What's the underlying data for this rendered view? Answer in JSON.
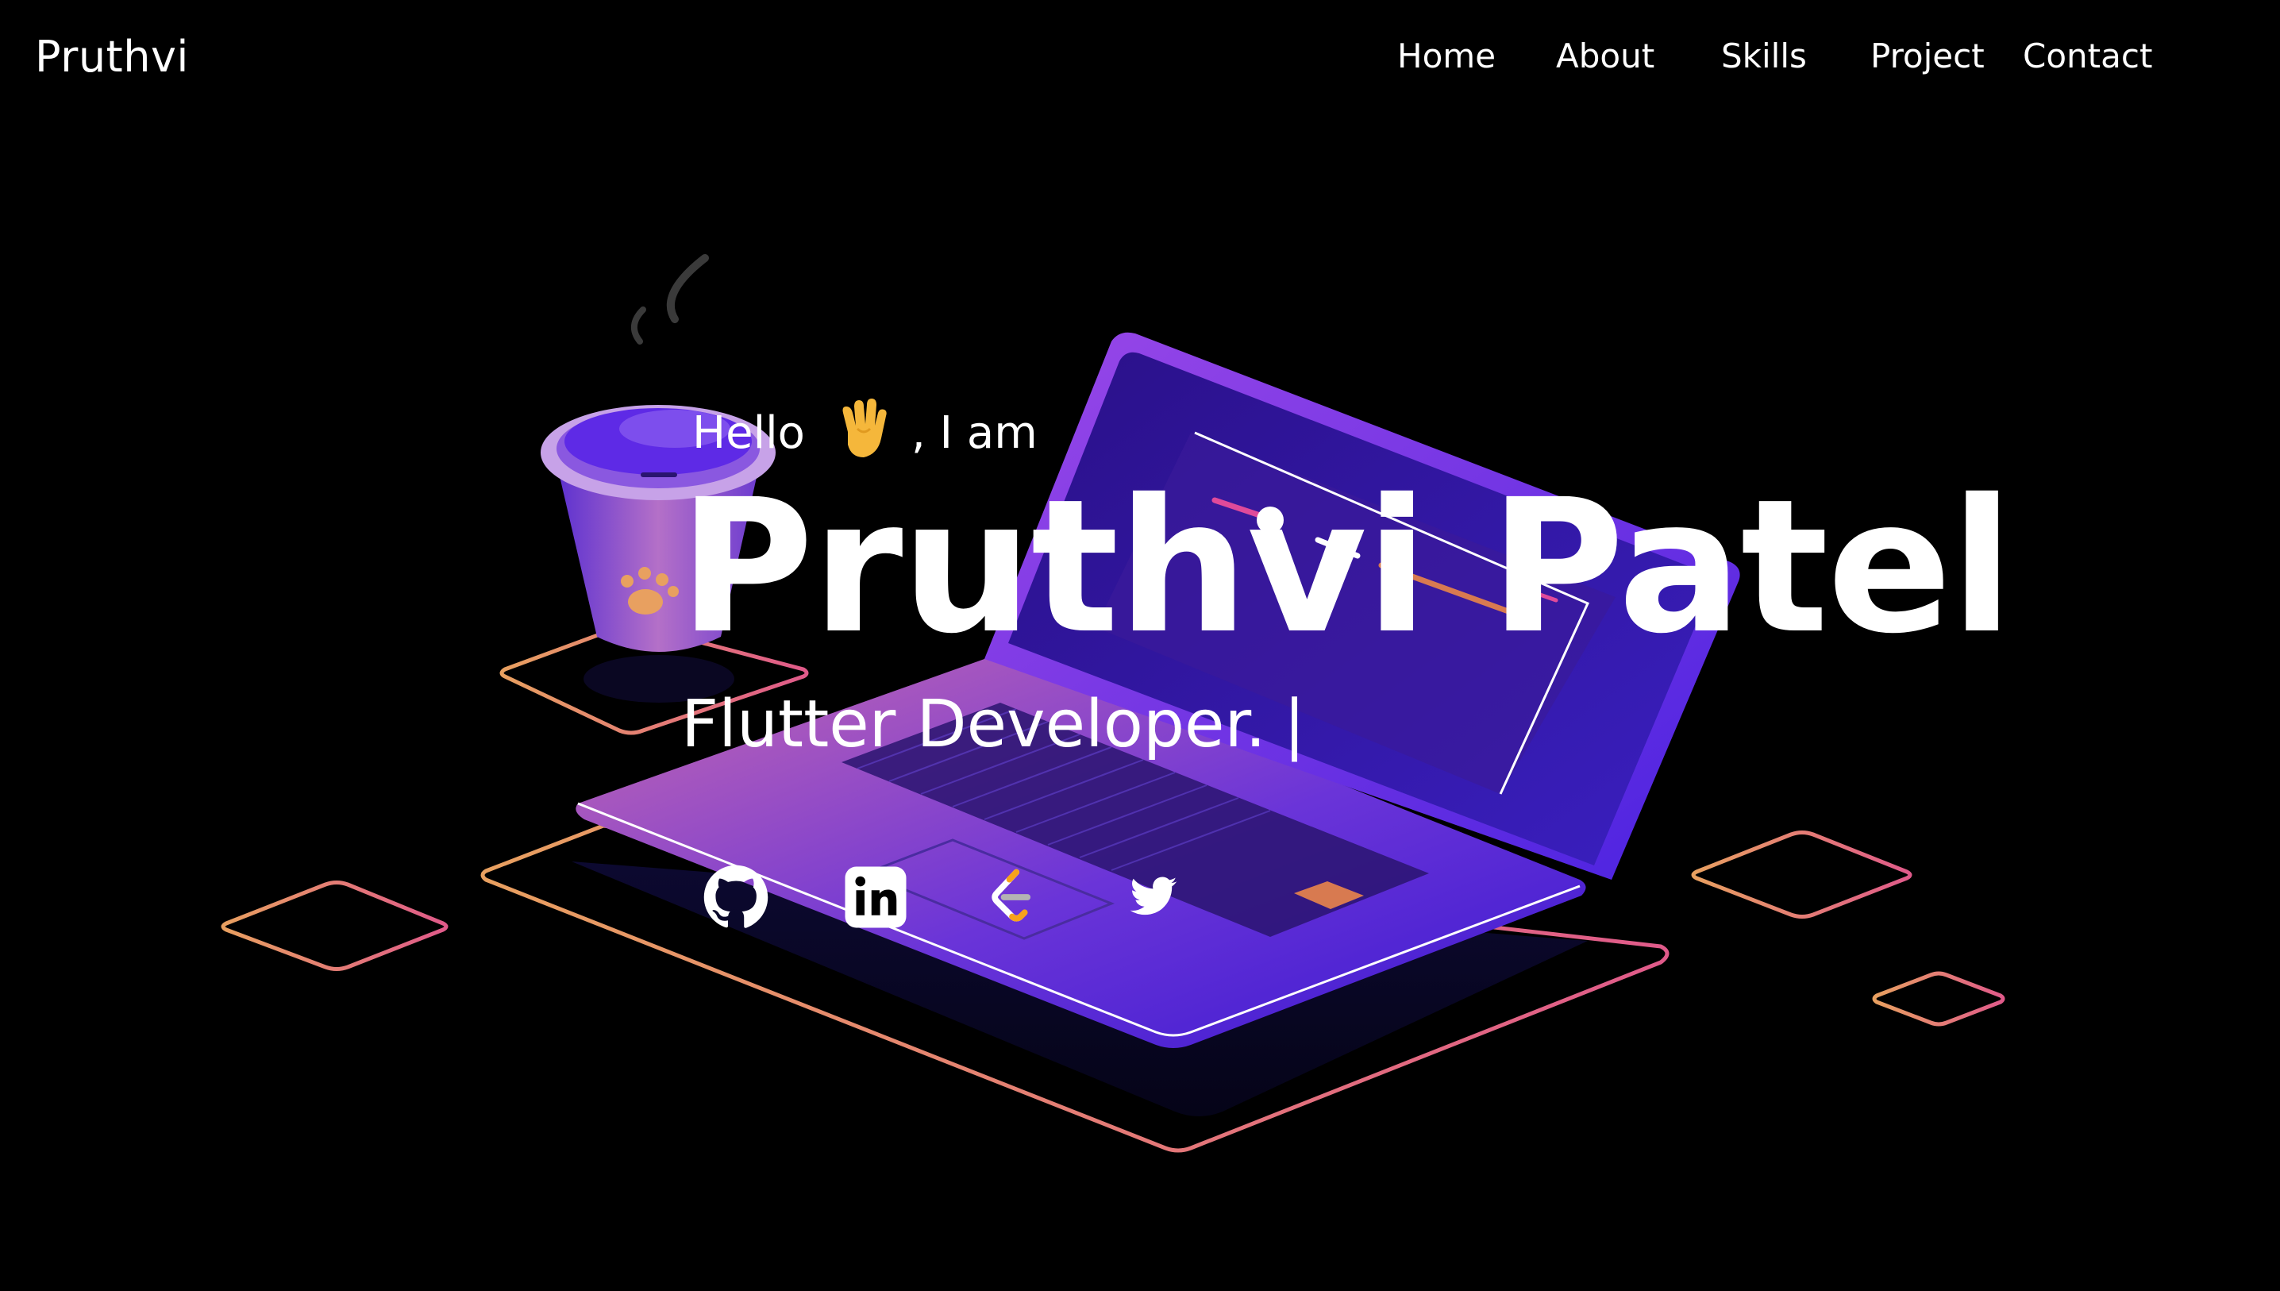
{
  "header": {
    "logo": "Pruthvi",
    "nav": [
      {
        "label": "Home"
      },
      {
        "label": "About"
      },
      {
        "label": "Skills"
      },
      {
        "label": "Project"
      },
      {
        "label": "Contact"
      }
    ]
  },
  "hero": {
    "greeting_prefix": "Hello",
    "greeting_suffix": ", I am",
    "wave_icon": "waving-hand",
    "name": "Pruthvi Patel",
    "role": "Flutter Developer.",
    "cursor": "|"
  },
  "social": [
    {
      "icon": "github-icon"
    },
    {
      "icon": "linkedin-icon"
    },
    {
      "icon": "leetcode-icon"
    },
    {
      "icon": "twitter-icon"
    }
  ],
  "colors": {
    "background": "#000000",
    "text": "#ffffff",
    "accent_purple": "#5b2be0",
    "accent_pink": "#e0608a",
    "accent_orange": "#e8a060"
  }
}
